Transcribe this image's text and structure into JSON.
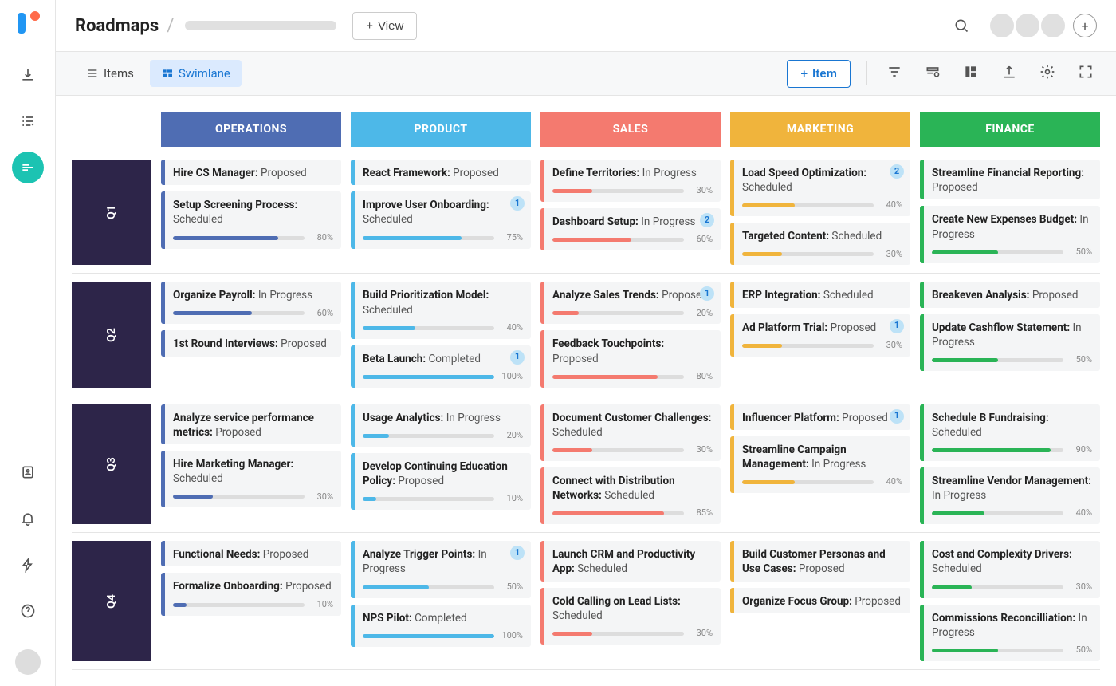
{
  "header": {
    "title": "Roadmaps",
    "view_btn": "View",
    "item_btn": "Item"
  },
  "toolbar": {
    "items_tab": "Items",
    "swimlane_tab": "Swimlane"
  },
  "lanes": [
    "OPERATIONS",
    "PRODUCT",
    "SALES",
    "MARKETING",
    "FINANCE"
  ],
  "quarters": [
    "Q1",
    "Q2",
    "Q3",
    "Q4"
  ],
  "grid": {
    "Q1": {
      "operations": [
        {
          "title": "Hire CS Manager",
          "status": "Proposed"
        },
        {
          "title": "Setup Screening Process",
          "status": "Scheduled",
          "progress": 80
        }
      ],
      "product": [
        {
          "title": "React Framework",
          "status": "Proposed"
        },
        {
          "title": "Improve User Onboarding",
          "status": "Scheduled",
          "progress": 75,
          "badge": 1
        }
      ],
      "sales": [
        {
          "title": "Define Territories",
          "status": "In Progress",
          "progress": 30
        },
        {
          "title": "Dashboard Setup",
          "status": "In Progress",
          "progress": 60,
          "badge": 2
        }
      ],
      "marketing": [
        {
          "title": "Load Speed Optimization",
          "status": "Scheduled",
          "progress": 40,
          "badge": 2
        },
        {
          "title": "Targeted Content",
          "status": "Scheduled",
          "progress": 30
        }
      ],
      "finance": [
        {
          "title": "Streamline Financial Reporting",
          "status": "Proposed"
        },
        {
          "title": "Create New Expenses Budget",
          "status": "In Progress",
          "progress": 50
        }
      ]
    },
    "Q2": {
      "operations": [
        {
          "title": "Organize Payroll",
          "status": "In Progress",
          "progress": 60
        },
        {
          "title": "1st Round Interviews",
          "status": "Proposed"
        }
      ],
      "product": [
        {
          "title": "Build Prioritization Model",
          "status": "Scheduled",
          "progress": 40
        },
        {
          "title": "Beta Launch",
          "status": "Completed",
          "progress": 100,
          "badge": 1
        }
      ],
      "sales": [
        {
          "title": "Analyze Sales Trends",
          "status": "Proposed",
          "progress": 20,
          "badge": 1
        },
        {
          "title": "Feedback Touchpoints",
          "status": "Proposed",
          "progress": 80
        }
      ],
      "marketing": [
        {
          "title": "ERP Integration",
          "status": "Scheduled"
        },
        {
          "title": "Ad Platform Trial",
          "status": "Proposed",
          "progress": 30,
          "badge": 1
        }
      ],
      "finance": [
        {
          "title": "Breakeven Analysis",
          "status": "Proposed"
        },
        {
          "title": "Update Cashflow Statement",
          "status": "In Progress",
          "progress": 50
        }
      ]
    },
    "Q3": {
      "operations": [
        {
          "title": "Analyze service performance metrics",
          "status": "Proposed"
        },
        {
          "title": "Hire Marketing Manager",
          "status": "Scheduled",
          "progress": 30
        }
      ],
      "product": [
        {
          "title": "Usage Analytics",
          "status": "In Progress",
          "progress": 20
        },
        {
          "title": "Develop Continuing Education Policy",
          "status": "Proposed",
          "progress": 10
        }
      ],
      "sales": [
        {
          "title": "Document Customer Challenges",
          "status": "Scheduled",
          "progress": 30
        },
        {
          "title": "Connect with Distribution Networks",
          "status": "Scheduled",
          "progress": 85
        }
      ],
      "marketing": [
        {
          "title": "Influencer Platform",
          "status": "Proposed",
          "badge": 1
        },
        {
          "title": "Streamline Campaign Management",
          "status": "In Progress",
          "progress": 40
        }
      ],
      "finance": [
        {
          "title": "Schedule B Fundraising",
          "status": "Scheduled",
          "progress": 90
        },
        {
          "title": "Streamline Vendor Management",
          "status": "In Progress",
          "progress": 40
        }
      ]
    },
    "Q4": {
      "operations": [
        {
          "title": "Functional Needs",
          "status": "Proposed"
        },
        {
          "title": "Formalize Onboarding",
          "status": "Proposed",
          "progress": 10
        }
      ],
      "product": [
        {
          "title": "Analyze Trigger Points",
          "status": "In Progress",
          "progress": 50,
          "badge": 1
        },
        {
          "title": "NPS Pilot",
          "status": "Completed",
          "progress": 100
        }
      ],
      "sales": [
        {
          "title": "Launch CRM and Productivity App",
          "status": "Scheduled"
        },
        {
          "title": "Cold Calling on Lead Lists",
          "status": "Scheduled",
          "progress": 30
        }
      ],
      "marketing": [
        {
          "title": "Build Customer Personas and Use Cases",
          "status": "Proposed"
        },
        {
          "title": "Organize Focus Group",
          "status": "Proposed"
        }
      ],
      "finance": [
        {
          "title": "Cost and Complexity Drivers",
          "status": "Scheduled",
          "progress": 30
        },
        {
          "title": "Commissions Reconcilliation",
          "status": "In Progress",
          "progress": 50
        }
      ]
    }
  }
}
